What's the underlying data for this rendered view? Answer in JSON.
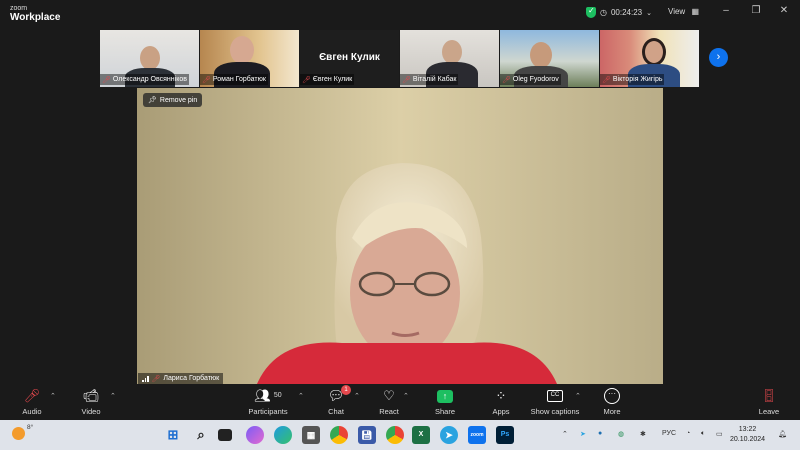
{
  "title_bar": {
    "app_line1": "zoom",
    "app_line2": "Workplace",
    "timer": "00:24:23",
    "view_label": "View"
  },
  "participants_strip": [
    {
      "name": "Олександр Овсянніков",
      "muted": true
    },
    {
      "name": "Роман Горбатюк",
      "muted": true
    },
    {
      "name": "Євген Кулик",
      "muted": true,
      "display_name_large": "Євген Кулик"
    },
    {
      "name": "Віталій Кабак",
      "muted": true
    },
    {
      "name": "Oleg Fyodorov",
      "muted": true
    },
    {
      "name": "Вікторія Жигірь",
      "muted": true
    }
  ],
  "main_video": {
    "pin_label": "Remove pin",
    "speaker_name": "Лариса Горбатюк"
  },
  "toolbar": {
    "audio": "Audio",
    "video": "Video",
    "participants": "Participants",
    "participants_count": "50",
    "chat": "Chat",
    "chat_badge": "1",
    "react": "React",
    "share": "Share",
    "apps": "Apps",
    "captions": "Show captions",
    "captions_icon_text": "CC",
    "more": "More",
    "leave": "Leave"
  },
  "taskbar": {
    "temperature": "8°",
    "language": "РУС",
    "time": "13:22",
    "date": "20.10.2024",
    "zoom_app_text": "zoom",
    "ps_app_text": "Ps",
    "excel_app_text": "X"
  },
  "colors": {
    "accent_blue": "#0e72ed",
    "share_green": "#1dbf61",
    "muted_red": "#e5484d"
  }
}
